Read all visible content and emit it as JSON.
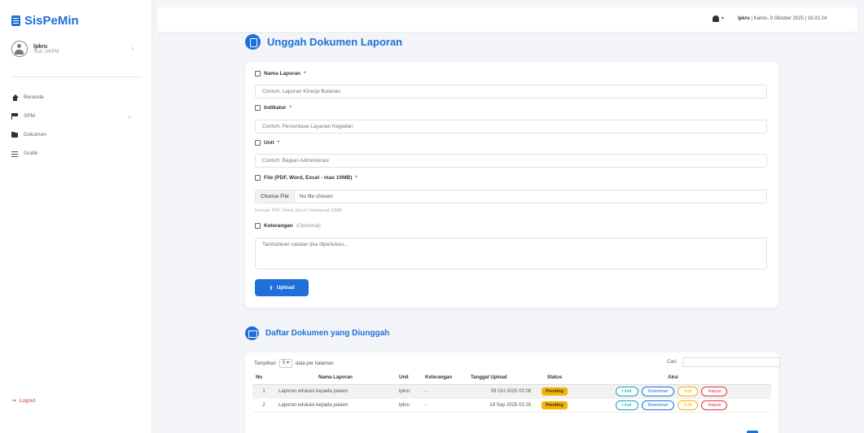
{
  "app": {
    "title": "SisPeMin"
  },
  "user": {
    "name": "lpkru",
    "role": "Staf, UKPM"
  },
  "sidebar": {
    "items": [
      {
        "label": "Beranda",
        "icon": "home-icon"
      },
      {
        "label": "SPM",
        "icon": "flag-icon"
      },
      {
        "label": "Dokumen",
        "icon": "folder-icon"
      },
      {
        "label": "Grafik",
        "icon": "chart-icon"
      }
    ],
    "logout_label": "Logout"
  },
  "topbar": {
    "user": "lpkru",
    "datetime": "Kamis, 9 Oktober 2025 | 16.02.24"
  },
  "upload_section": {
    "title": "Unggah Dokumen Laporan",
    "fields": {
      "nama": {
        "label": "Nama Laporan",
        "placeholder": "Contoh: Laporan Kinerja Bulanan"
      },
      "indikator": {
        "label": "Indikator",
        "placeholder": "Contoh: Persentase Layanan Kegiatan"
      },
      "unit": {
        "label": "Unit",
        "placeholder": "Contoh: Bagian Administrasi"
      },
      "file": {
        "label": "File (PDF, Word, Excel - max 10MB)",
        "button": "Choose File",
        "status": "No file chosen",
        "help": "Format: PDF, Word, Excel | Maksimal 10MB"
      },
      "keterangan": {
        "label": "Keterangan",
        "optional": "(Opsional)",
        "placeholder": "Tambahkan catatan jika diperlukan..."
      }
    },
    "submit_label": "Upload"
  },
  "list_section": {
    "title": "Daftar Dokumen yang Diunggah",
    "show_prefix": "Tampilkan",
    "show_value": "5",
    "show_suffix": "data per halaman",
    "search_label": "Cari:",
    "columns": [
      "No",
      "Nama Laporan",
      "Unit",
      "Keterangan",
      "Tanggal Upload",
      "Status",
      "Aksi"
    ],
    "rows": [
      {
        "no": "1",
        "nama": "Laporan edukasi kepada pasien",
        "unit": "lpkru",
        "keterangan": "-",
        "tanggal": "09 Oct 2025 02:08",
        "status": "Pending"
      },
      {
        "no": "2",
        "nama": "Laporan edukasi kepada pasien",
        "unit": "lpkru",
        "keterangan": "-",
        "tanggal": "19 Sep 2025 02:16",
        "status": "Pending"
      }
    ],
    "actions": {
      "view": "Lihat",
      "download": "Download",
      "edit": "Edit",
      "delete": "Hapus"
    }
  },
  "colors": {
    "primary": "#1e6fd9",
    "warning": "#f5b400",
    "danger": "#d9363e",
    "info": "#17a2b8"
  }
}
